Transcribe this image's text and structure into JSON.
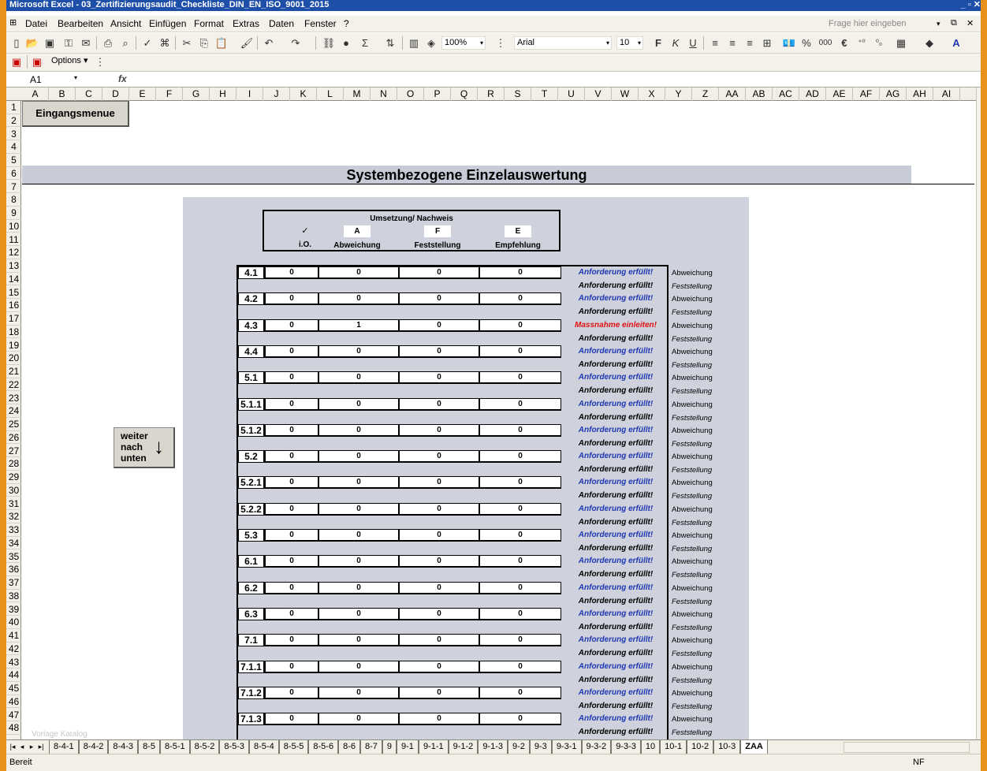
{
  "window": {
    "title": "Microsoft Excel - 03_Zertifizierungsaudit_Checkliste_DIN_EN_ISO_9001_2015",
    "controls": "_ ▫ ✕"
  },
  "menu": {
    "items": [
      "Datei",
      "Bearbeiten",
      "Ansicht",
      "Einfügen",
      "Format",
      "Extras",
      "Daten",
      "Fenster",
      "?"
    ],
    "help_placeholder": "Frage hier eingeben"
  },
  "toolbar": {
    "zoom": "100%",
    "font": "Arial",
    "size": "10",
    "options_label": "Options ▾",
    "icons": [
      "new-icon",
      "open-icon",
      "save-icon",
      "permission-icon",
      "email-icon",
      "print-icon",
      "print-preview-icon",
      "spelling-icon",
      "research-icon",
      "cut-icon",
      "copy-icon",
      "paste-icon",
      "format-painter-icon",
      "undo-icon",
      "redo-icon",
      "hyperlink-icon",
      "autosum-icon",
      "sort-icon",
      "chart-icon",
      "drawing-icon",
      "bold-icon",
      "italic-icon",
      "underline-icon",
      "align-left-icon",
      "center-icon",
      "align-right-icon",
      "merge-icon",
      "currency-icon",
      "percent-icon",
      "thousands-icon",
      "euro-icon",
      "borders-icon",
      "fill-color-icon",
      "font-color-icon"
    ]
  },
  "formula_bar": {
    "name_box": "A1",
    "fx": "fx"
  },
  "columns": [
    "A",
    "B",
    "C",
    "D",
    "E",
    "F",
    "G",
    "H",
    "I",
    "J",
    "K",
    "L",
    "M",
    "N",
    "O",
    "P",
    "Q",
    "R",
    "S",
    "T",
    "U",
    "V",
    "W",
    "X",
    "Y",
    "Z",
    "AA",
    "AB",
    "AC",
    "AD",
    "AE",
    "AF",
    "AG",
    "AH",
    "AI"
  ],
  "rows": [
    "1",
    "2",
    "3",
    "4",
    "5",
    "6",
    "7",
    "8",
    "9",
    "10",
    "11",
    "12",
    "13",
    "14",
    "15",
    "16",
    "17",
    "18",
    "19",
    "20",
    "21",
    "22",
    "23",
    "24",
    "25",
    "26",
    "27",
    "28",
    "29",
    "30",
    "31",
    "32",
    "33",
    "34",
    "35",
    "36",
    "37",
    "38",
    "39",
    "40",
    "41",
    "42",
    "43",
    "44",
    "45",
    "46",
    "47",
    "48"
  ],
  "sheet": {
    "menu_button": "Eingangsmenue",
    "title": "Systembezogene Einzelauswertung",
    "weiter_button": [
      "weiter",
      "nach",
      "unten"
    ],
    "weiter_arrow": "↓",
    "legend": {
      "title": "Umsetzung/ Nachweis",
      "columns": [
        {
          "box": "✓",
          "label": "i.O."
        },
        {
          "box": "A",
          "label": "Abweichung"
        },
        {
          "box": "F",
          "label": "Feststellung"
        },
        {
          "box": "E",
          "label": "Empfehlung"
        }
      ]
    },
    "side_labels": [
      "Abweichung",
      "Feststellung"
    ],
    "status_text": {
      "ok": "Anforderung erfüllt!",
      "warn": "Massnahme einleiten!"
    },
    "entries": [
      {
        "id": "4.1",
        "values": [
          "0",
          "0",
          "0",
          "0"
        ],
        "status": "Anforderung erfüllt!",
        "status_type": "ok",
        "status2": "Anforderung erfüllt!"
      },
      {
        "id": "4.2",
        "values": [
          "0",
          "0",
          "0",
          "0"
        ],
        "status": "Anforderung erfüllt!",
        "status_type": "ok",
        "status2": "Anforderung erfüllt!"
      },
      {
        "id": "4.3",
        "values": [
          "0",
          "1",
          "0",
          "0"
        ],
        "status": "Massnahme einleiten!",
        "status_type": "warn",
        "status2": "Anforderung erfüllt!"
      },
      {
        "id": "4.4",
        "values": [
          "0",
          "0",
          "0",
          "0"
        ],
        "status": "Anforderung erfüllt!",
        "status_type": "ok",
        "status2": "Anforderung erfüllt!"
      },
      {
        "id": "5.1",
        "values": [
          "0",
          "0",
          "0",
          "0"
        ],
        "status": "Anforderung erfüllt!",
        "status_type": "ok",
        "status2": "Anforderung erfüllt!"
      },
      {
        "id": "5.1.1",
        "values": [
          "0",
          "0",
          "0",
          "0"
        ],
        "status": "Anforderung erfüllt!",
        "status_type": "ok",
        "status2": "Anforderung erfüllt!"
      },
      {
        "id": "5.1.2",
        "values": [
          "0",
          "0",
          "0",
          "0"
        ],
        "status": "Anforderung erfüllt!",
        "status_type": "ok",
        "status2": "Anforderung erfüllt!"
      },
      {
        "id": "5.2",
        "values": [
          "0",
          "0",
          "0",
          "0"
        ],
        "status": "Anforderung erfüllt!",
        "status_type": "ok",
        "status2": "Anforderung erfüllt!"
      },
      {
        "id": "5.2.1",
        "values": [
          "0",
          "0",
          "0",
          "0"
        ],
        "status": "Anforderung erfüllt!",
        "status_type": "ok",
        "status2": "Anforderung erfüllt!"
      },
      {
        "id": "5.2.2",
        "values": [
          "0",
          "0",
          "0",
          "0"
        ],
        "status": "Anforderung erfüllt!",
        "status_type": "ok",
        "status2": "Anforderung erfüllt!"
      },
      {
        "id": "5.3",
        "values": [
          "0",
          "0",
          "0",
          "0"
        ],
        "status": "Anforderung erfüllt!",
        "status_type": "ok",
        "status2": "Anforderung erfüllt!"
      },
      {
        "id": "6.1",
        "values": [
          "0",
          "0",
          "0",
          "0"
        ],
        "status": "Anforderung erfüllt!",
        "status_type": "ok",
        "status2": "Anforderung erfüllt!"
      },
      {
        "id": "6.2",
        "values": [
          "0",
          "0",
          "0",
          "0"
        ],
        "status": "Anforderung erfüllt!",
        "status_type": "ok",
        "status2": "Anforderung erfüllt!"
      },
      {
        "id": "6.3",
        "values": [
          "0",
          "0",
          "0",
          "0"
        ],
        "status": "Anforderung erfüllt!",
        "status_type": "ok",
        "status2": "Anforderung erfüllt!"
      },
      {
        "id": "7.1",
        "values": [
          "0",
          "0",
          "0",
          "0"
        ],
        "status": "Anforderung erfüllt!",
        "status_type": "ok",
        "status2": "Anforderung erfüllt!"
      },
      {
        "id": "7.1.1",
        "values": [
          "0",
          "0",
          "0",
          "0"
        ],
        "status": "Anforderung erfüllt!",
        "status_type": "ok",
        "status2": "Anforderung erfüllt!"
      },
      {
        "id": "7.1.2",
        "values": [
          "0",
          "0",
          "0",
          "0"
        ],
        "status": "Anforderung erfüllt!",
        "status_type": "ok",
        "status2": "Anforderung erfüllt!"
      },
      {
        "id": "7.1.3",
        "values": [
          "0",
          "0",
          "0",
          "0"
        ],
        "status": "Anforderung erfüllt!",
        "status_type": "ok",
        "status2": "Anforderung erfüllt!"
      }
    ],
    "watermark": "Vorlage Katalog"
  },
  "sheet_tabs": [
    "8-4-1",
    "8-4-2",
    "8-4-3",
    "8-5",
    "8-5-1",
    "8-5-2",
    "8-5-3",
    "8-5-4",
    "8-5-5",
    "8-5-6",
    "8-6",
    "8-7",
    "9",
    "9-1",
    "9-1-1",
    "9-1-2",
    "9-1-3",
    "9-2",
    "9-3",
    "9-3-1",
    "9-3-2",
    "9-3-3",
    "10",
    "10-1",
    "10-2",
    "10-3",
    "ZAA"
  ],
  "active_tab": "ZAA",
  "status_bar": {
    "left": "Bereit",
    "right": "NF"
  },
  "colors": {
    "ok": "#1f37b0",
    "warn": "#e01010",
    "panel": "#cfd2dc",
    "frame": "#e8901a"
  }
}
